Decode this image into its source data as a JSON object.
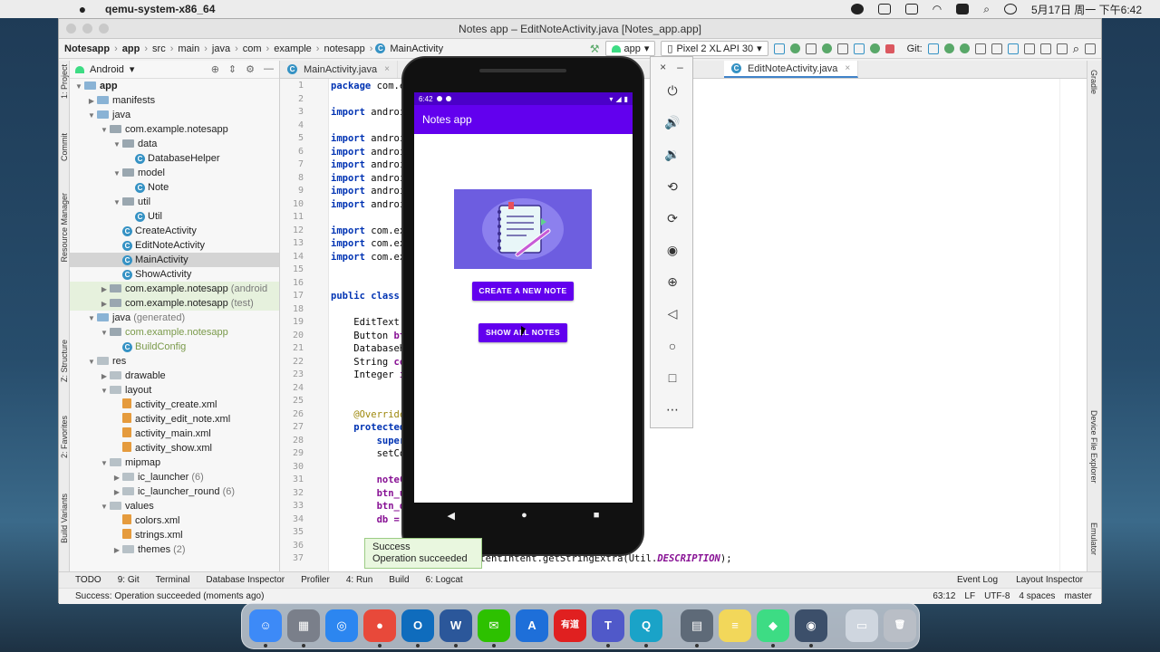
{
  "menubar": {
    "app_name": "qemu-system-x86_64",
    "datetime": "5月17日 周一 下午6:42"
  },
  "window": {
    "title": "Notes app – EditNoteActivity.java [Notes_app.app]"
  },
  "navbar": {
    "crumbs": [
      "Notesapp",
      "app",
      "src",
      "main",
      "java",
      "com",
      "example",
      "notesapp",
      "MainActivity"
    ],
    "run_config": "app",
    "device": "Pixel 2 XL API 30",
    "git_label": "Git:"
  },
  "project": {
    "view_mode": "Android",
    "tree": [
      {
        "label": "app",
        "indent": 0,
        "arrow": "down",
        "icon": "folder",
        "bold": true
      },
      {
        "label": "manifests",
        "indent": 1,
        "arrow": "right",
        "icon": "folder"
      },
      {
        "label": "java",
        "indent": 1,
        "arrow": "down",
        "icon": "folder"
      },
      {
        "label": "com.example.notesapp",
        "indent": 2,
        "arrow": "down",
        "icon": "pkg"
      },
      {
        "label": "data",
        "indent": 3,
        "arrow": "down",
        "icon": "pkg"
      },
      {
        "label": "DatabaseHelper",
        "indent": 4,
        "arrow": "",
        "icon": "class"
      },
      {
        "label": "model",
        "indent": 3,
        "arrow": "down",
        "icon": "pkg"
      },
      {
        "label": "Note",
        "indent": 4,
        "arrow": "",
        "icon": "class"
      },
      {
        "label": "util",
        "indent": 3,
        "arrow": "down",
        "icon": "pkg"
      },
      {
        "label": "Util",
        "indent": 4,
        "arrow": "",
        "icon": "class"
      },
      {
        "label": "CreateActivity",
        "indent": 3,
        "arrow": "",
        "icon": "class"
      },
      {
        "label": "EditNoteActivity",
        "indent": 3,
        "arrow": "",
        "icon": "class"
      },
      {
        "label": "MainActivity",
        "indent": 3,
        "arrow": "",
        "icon": "class",
        "selected": true
      },
      {
        "label": "ShowActivity",
        "indent": 3,
        "arrow": "",
        "icon": "class"
      },
      {
        "label": "com.example.notesapp",
        "suffix": " (android",
        "indent": 2,
        "arrow": "right",
        "icon": "pkg",
        "green": true
      },
      {
        "label": "com.example.notesapp",
        "suffix": " (test)",
        "indent": 2,
        "arrow": "right",
        "icon": "pkg",
        "green": true
      },
      {
        "label": "java",
        "suffix": " (generated)",
        "indent": 1,
        "arrow": "down",
        "icon": "folder"
      },
      {
        "label": "com.example.notesapp",
        "indent": 2,
        "arrow": "down",
        "icon": "pkg",
        "gen": true
      },
      {
        "label": "BuildConfig",
        "indent": 3,
        "arrow": "",
        "icon": "class",
        "gen": true
      },
      {
        "label": "res",
        "indent": 1,
        "arrow": "down",
        "icon": "res"
      },
      {
        "label": "drawable",
        "indent": 2,
        "arrow": "right",
        "icon": "res"
      },
      {
        "label": "layout",
        "indent": 2,
        "arrow": "down",
        "icon": "res"
      },
      {
        "label": "activity_create.xml",
        "indent": 3,
        "arrow": "",
        "icon": "xml"
      },
      {
        "label": "activity_edit_note.xml",
        "indent": 3,
        "arrow": "",
        "icon": "xml"
      },
      {
        "label": "activity_main.xml",
        "indent": 3,
        "arrow": "",
        "icon": "xml"
      },
      {
        "label": "activity_show.xml",
        "indent": 3,
        "arrow": "",
        "icon": "xml"
      },
      {
        "label": "mipmap",
        "indent": 2,
        "arrow": "down",
        "icon": "res"
      },
      {
        "label": "ic_launcher",
        "suffix": " (6)",
        "indent": 3,
        "arrow": "right",
        "icon": "res"
      },
      {
        "label": "ic_launcher_round",
        "suffix": " (6)",
        "indent": 3,
        "arrow": "right",
        "icon": "res"
      },
      {
        "label": "values",
        "indent": 2,
        "arrow": "down",
        "icon": "res"
      },
      {
        "label": "colors.xml",
        "indent": 3,
        "arrow": "",
        "icon": "xml"
      },
      {
        "label": "strings.xml",
        "indent": 3,
        "arrow": "",
        "icon": "xml"
      },
      {
        "label": "themes",
        "suffix": " (2)",
        "indent": 3,
        "arrow": "right",
        "icon": "res"
      }
    ]
  },
  "left_tool_tabs": [
    "1: Project",
    "Commit",
    "Resource Manager",
    "Z: Structure",
    "2: Favorites",
    "Build Variants"
  ],
  "right_tool_tabs": [
    "Gradle",
    "Device File Explorer",
    "Emulator"
  ],
  "editor": {
    "tabs": [
      {
        "label": "MainActivity.java",
        "active": false
      },
      {
        "label": "EditNoteActivity.java",
        "active": true
      }
    ],
    "line_numbers": [
      "1",
      "2",
      "3",
      "4",
      "5",
      "6",
      "7",
      "8",
      "9",
      "10",
      "11",
      "12",
      "13",
      "14",
      "15",
      "16",
      "17",
      "18",
      "19",
      "20",
      "21",
      "22",
      "23",
      "24",
      "25",
      "26",
      "27",
      "28",
      "29",
      "30",
      "31",
      "32",
      "33",
      "34",
      "35",
      "36",
      "37"
    ],
    "lines": [
      [
        {
          "t": "package ",
          "c": "kw"
        },
        {
          "t": "com.ex",
          "c": ""
        }
      ],
      [],
      [
        {
          "t": "import ",
          "c": "kw"
        },
        {
          "t": "android",
          "c": ""
        }
      ],
      [],
      [
        {
          "t": "import ",
          "c": "kw"
        },
        {
          "t": "android",
          "c": ""
        }
      ],
      [
        {
          "t": "import ",
          "c": "kw"
        },
        {
          "t": "android",
          "c": ""
        }
      ],
      [
        {
          "t": "import ",
          "c": "kw"
        },
        {
          "t": "android",
          "c": ""
        }
      ],
      [
        {
          "t": "import ",
          "c": "kw"
        },
        {
          "t": "android",
          "c": ""
        }
      ],
      [
        {
          "t": "import ",
          "c": "kw"
        },
        {
          "t": "android",
          "c": ""
        }
      ],
      [
        {
          "t": "import ",
          "c": "kw"
        },
        {
          "t": "android",
          "c": ""
        }
      ],
      [],
      [
        {
          "t": "import ",
          "c": "kw"
        },
        {
          "t": "com.exa",
          "c": ""
        }
      ],
      [
        {
          "t": "import ",
          "c": "kw"
        },
        {
          "t": "com.exa",
          "c": ""
        }
      ],
      [
        {
          "t": "import ",
          "c": "kw"
        },
        {
          "t": "com.exa",
          "c": ""
        }
      ],
      [],
      [],
      [
        {
          "t": "public class ",
          "c": "kw"
        },
        {
          "t": "E",
          "c": ""
        }
      ],
      [],
      [
        {
          "t": "    EditText ",
          "c": ""
        },
        {
          "t": "n",
          "c": "fld"
        }
      ],
      [
        {
          "t": "    Button ",
          "c": ""
        },
        {
          "t": "btn",
          "c": "fld"
        }
      ],
      [
        {
          "t": "    DatabaseHe",
          "c": ""
        }
      ],
      [
        {
          "t": "    String ",
          "c": ""
        },
        {
          "t": "con",
          "c": "fld"
        }
      ],
      [
        {
          "t": "    Integer ",
          "c": ""
        },
        {
          "t": "id",
          "c": "fld"
        }
      ],
      [],
      [],
      [
        {
          "t": "    @Override",
          "c": "an"
        }
      ],
      [
        {
          "t": "    protected ",
          "c": "kw"
        }
      ],
      [
        {
          "t": "        super.",
          "c": "kw"
        }
      ],
      [
        {
          "t": "        setCon",
          "c": ""
        }
      ],
      [],
      [
        {
          "t": "        noteCo",
          "c": "fld"
        }
      ],
      [
        {
          "t": "        btn_up",
          "c": "fld"
        }
      ],
      [
        {
          "t": "        btn_de",
          "c": "fld"
        }
      ],
      [
        {
          "t": "        db = n",
          "c": "fld"
        }
      ],
      [],
      [],
      [
        {
          "t": "                    getContentIntent.getStringExtra(Util.",
          "c": ""
        },
        {
          "t": "DESCRIPTION",
          "c": "fld it"
        },
        {
          "t": ");",
          "c": ""
        }
      ]
    ]
  },
  "bottom_tools": [
    "TODO",
    "9: Git",
    "Terminal",
    "Database Inspector",
    "Profiler",
    "4: Run",
    "Build",
    "6: Logcat"
  ],
  "bottom_right_tools": [
    "Event Log",
    "Layout Inspector"
  ],
  "status": {
    "message": "Success: Operation succeeded (moments ago)",
    "position": "63:12",
    "line_sep": "LF",
    "encoding": "UTF-8",
    "indent": "4 spaces",
    "branch": "master"
  },
  "toast": {
    "line1": "Success",
    "line2": "Operation succeeded"
  },
  "emulator_tools": [
    "power-icon",
    "volume-up-icon",
    "volume-down-icon",
    "rotate-left-icon",
    "rotate-right-icon",
    "camera-icon",
    "zoom-icon",
    "back-icon",
    "home-icon",
    "overview-icon",
    "more-icon"
  ],
  "phone": {
    "time": "6:42",
    "app_title": "Notes app",
    "btn_create": "CREATE A NEW NOTE",
    "btn_show": "SHOW ALL NOTES",
    "accent": "#6200ee"
  },
  "dock": {
    "apps": [
      {
        "name": "Finder",
        "color": "#3d8af7",
        "glyph": "☺"
      },
      {
        "name": "Launchpad",
        "color": "#7a7f8a",
        "glyph": "▦"
      },
      {
        "name": "Safari",
        "color": "#2c86f0",
        "glyph": "◎"
      },
      {
        "name": "Chrome",
        "color": "#e8493a",
        "glyph": "●"
      },
      {
        "name": "Outlook",
        "color": "#0f6cbd",
        "glyph": "O"
      },
      {
        "name": "Word",
        "color": "#2b579a",
        "glyph": "W"
      },
      {
        "name": "WeChat",
        "color": "#2dc100",
        "glyph": "✉"
      },
      {
        "name": "Xcode",
        "color": "#1e6fd9",
        "glyph": "A"
      },
      {
        "name": "Youdao",
        "color": "#e02020",
        "glyph": "有道"
      },
      {
        "name": "Teams",
        "color": "#5059c9",
        "glyph": "T"
      },
      {
        "name": "QuickTime",
        "color": "#1aa3c8",
        "glyph": "Q"
      },
      {
        "name": "Preview",
        "color": "#5e6a78",
        "glyph": "▤"
      },
      {
        "name": "Stickies",
        "color": "#f2d75a",
        "glyph": "≡"
      },
      {
        "name": "Android Studio",
        "color": "#3ddc84",
        "glyph": "◆"
      },
      {
        "name": "Emulator",
        "color": "#3c4f6a",
        "glyph": "◉"
      },
      {
        "name": "Screenshot",
        "color": "#cfd6df",
        "glyph": "▭"
      },
      {
        "name": "Trash",
        "color": "#b9bec6",
        "glyph": "🗑"
      }
    ]
  }
}
